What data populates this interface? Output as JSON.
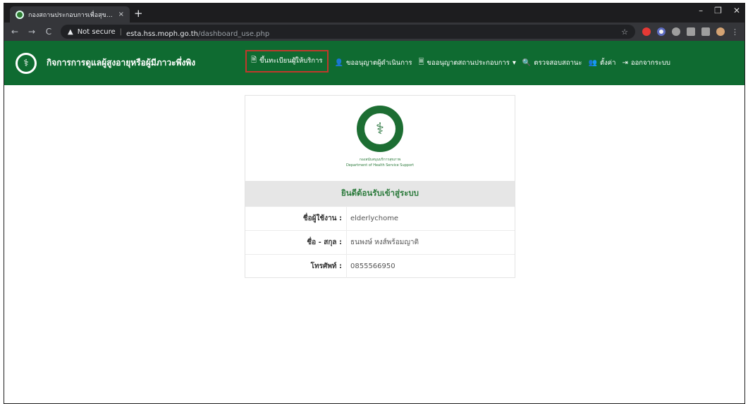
{
  "browser": {
    "tab_title": "กองสถานประกอบการเพื่อสุขภาพ กรม",
    "tab_close": "×",
    "new_tab": "+",
    "window_controls": [
      "–",
      "❐",
      "✕"
    ],
    "nav": {
      "back": "←",
      "forward": "→",
      "reload": "C"
    },
    "address": {
      "warning_icon": "▲",
      "not_secure": "Not secure",
      "separator": "|",
      "host": "esta.hss.moph.go.th",
      "path": "/dashboard_use.php"
    },
    "extension_colors": [
      "#e53935",
      "#5c6bc0",
      "#9e9e9e",
      "#9e9e9e",
      "#9e9e9e",
      "#d4a373"
    ]
  },
  "navbar": {
    "brand_title": "กิจการการดูแลผู้สูงอายุหรือผู้มีภาวะพึ่งพิง",
    "items": [
      {
        "icon": "🗎",
        "label": "ขึ้นทะเบียนผู้ให้บริการ",
        "highlighted": true
      },
      {
        "icon": "👤",
        "label": "ขออนุญาตผู้ดำเนินการ"
      },
      {
        "icon": "🗏",
        "label": "ขออนุญาตสถานประกอบการ",
        "caret": "▾"
      },
      {
        "icon": "🔍",
        "label": "ตรวจสอบสถานะ"
      },
      {
        "icon": "👥",
        "label": "ตั้งค่า"
      },
      {
        "icon": "⇥",
        "label": "ออกจากระบบ"
      }
    ]
  },
  "card": {
    "dept_th": "กองสนับสนุนบริการสุขภาพ",
    "dept_en": "Department of Health Service Support",
    "welcome": "ยินดีต้อนรับเข้าสู่ระบบ",
    "rows": [
      {
        "label": "ชื่อผู้ใช้งาน :",
        "value": "elderlychome"
      },
      {
        "label": "ชื่อ - สกุล :",
        "value": "ธนพงษ์ หงส์พร้อมญาติ"
      },
      {
        "label": "โทรศัพท์ :",
        "value": "0855566950"
      }
    ]
  },
  "accent_colors": {
    "navbar_green": "#0f6b31",
    "highlight_red": "#c0392b",
    "heading_green": "#2b7a3b"
  }
}
